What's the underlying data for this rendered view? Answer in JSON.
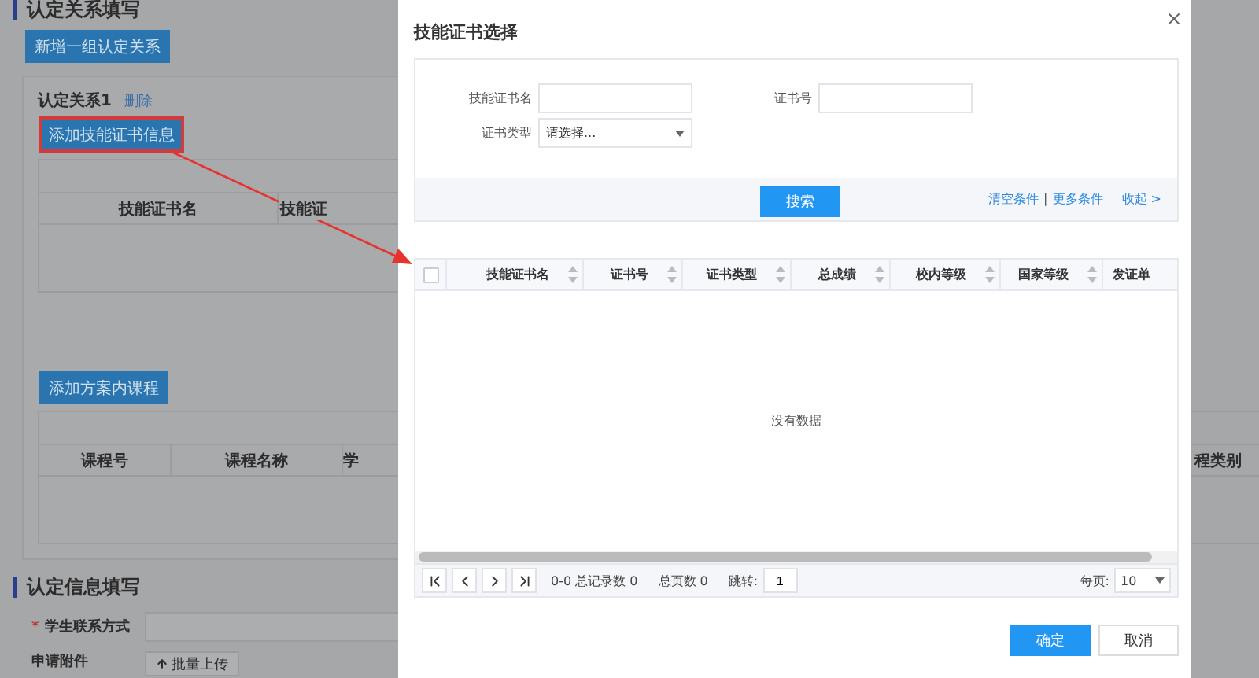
{
  "background": {
    "section_title": "认定关系填写",
    "add_group_button": "新增一组认定关系",
    "relation": {
      "title": "认定关系1",
      "delete_link": "删除",
      "add_cert_button": "添加技能证书信息",
      "add_cert_highlighted": true,
      "cert_columns": [
        "技能证书名",
        "技能证"
      ],
      "add_course_button": "添加方案内课程",
      "course_columns": [
        "课程号",
        "课程名称",
        "学"
      ],
      "course_column_right": "程类别"
    },
    "info_section_title": "认定信息填写",
    "contact": {
      "label": "学生联系方式",
      "required": true,
      "required_mark": "*"
    },
    "attachment_label": "申请附件",
    "upload_button": "批量上传"
  },
  "dialog": {
    "title": "技能证书选择",
    "search": {
      "fields": [
        {
          "label": "技能证书名",
          "kind": "text"
        },
        {
          "label": "证书号",
          "kind": "text"
        },
        {
          "label": "证书类型",
          "kind": "select",
          "value": "请选择..."
        }
      ],
      "search_button": "搜索",
      "links": [
        "清空条件",
        "更多条件"
      ],
      "separator": "|",
      "collapse_link": "收起 >"
    },
    "table": {
      "select_all_checked": false,
      "columns": [
        {
          "label": "技能证书名",
          "sortable": true
        },
        {
          "label": "证书号",
          "sortable": true
        },
        {
          "label": "证书类型",
          "sortable": true
        },
        {
          "label": "总成绩",
          "sortable": true
        },
        {
          "label": "校内等级",
          "sortable": true
        },
        {
          "label": "国家等级",
          "sortable": true
        },
        {
          "label": "发证单",
          "sortable": false
        }
      ],
      "empty_text": "没有数据"
    },
    "pager": {
      "records": "0-0 总记录数 0",
      "pages": "总页数 0",
      "jump_label": "跳转:",
      "jump_value": "1",
      "per_page_label": "每页:",
      "per_page_value": "10"
    },
    "buttons": [
      {
        "label": "确定",
        "primary": true
      },
      {
        "label": "取消",
        "primary": false
      }
    ]
  }
}
